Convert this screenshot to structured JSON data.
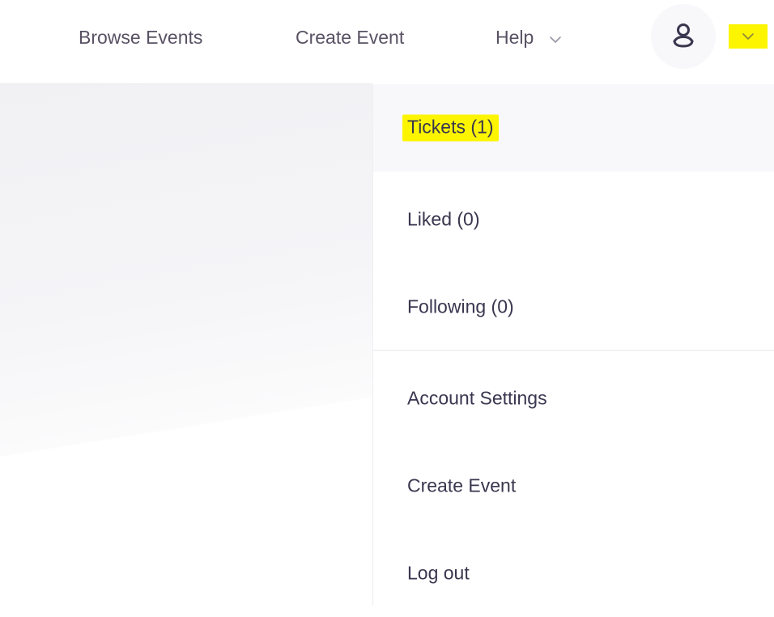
{
  "nav": {
    "browse_events": "Browse Events",
    "create_event": "Create Event",
    "help": "Help"
  },
  "account_menu": {
    "items": [
      {
        "label": "Tickets (1)",
        "active": true
      },
      {
        "label": "Liked (0)"
      },
      {
        "label": "Following (0)"
      },
      {
        "label": "Account Settings"
      },
      {
        "label": "Create Event"
      },
      {
        "label": "Log out"
      }
    ]
  },
  "icons": {
    "avatar": "user-icon",
    "help_chevron": "chevron-down-icon",
    "account_caret": "chevron-down-icon"
  },
  "colors": {
    "highlight": "#fdf500",
    "text": "#39364f",
    "nav_text": "#585163",
    "active_row": "#f8f7fa"
  }
}
